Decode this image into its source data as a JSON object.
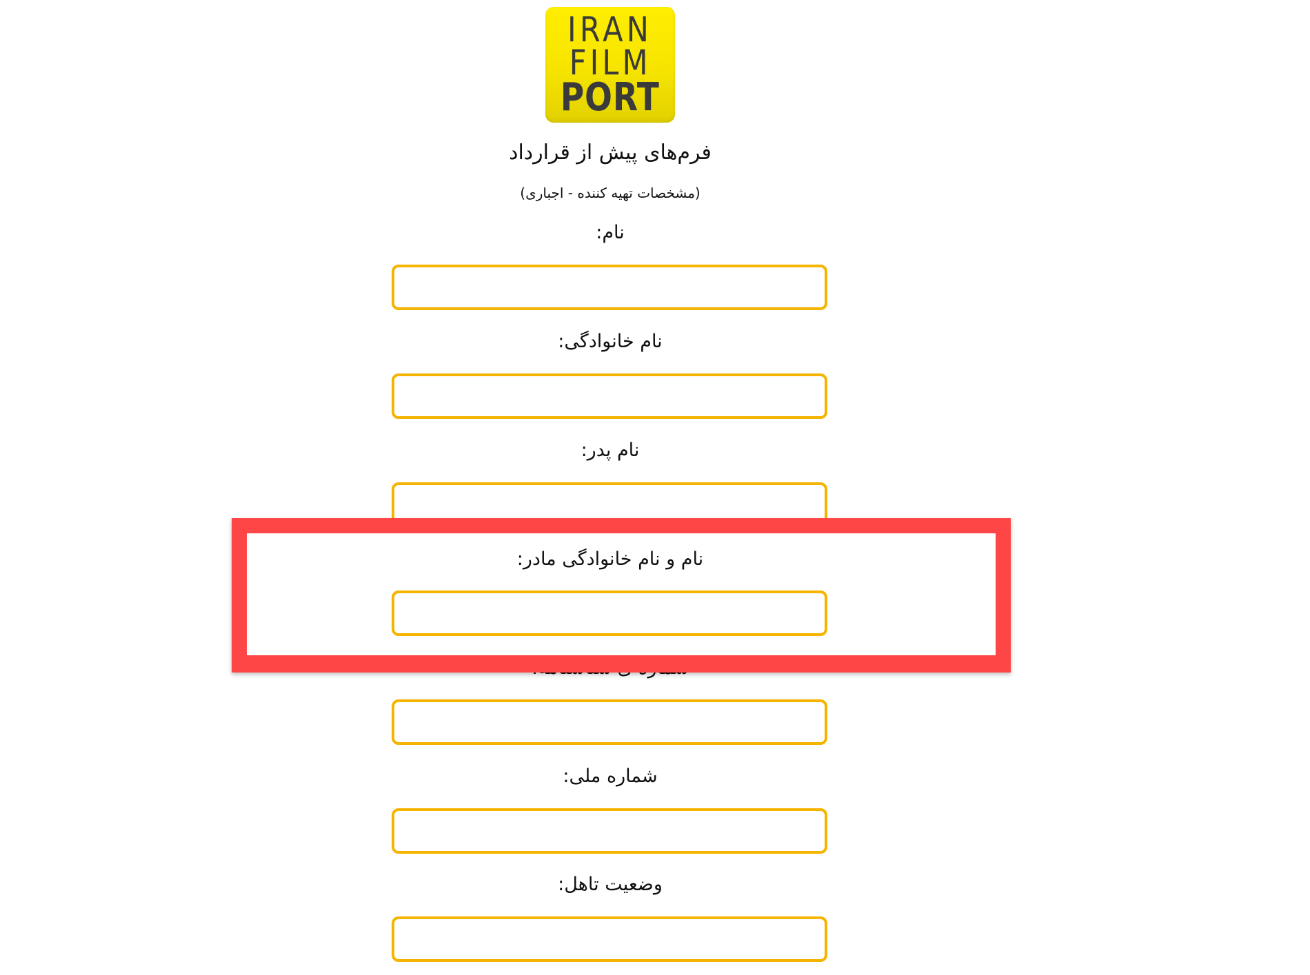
{
  "logo": {
    "line1": "IRAN",
    "line2": "FILM",
    "line3": "PORT",
    "background_color": "#f6e400"
  },
  "header": {
    "title": "فرم‌های پیش از قرارداد",
    "subtitle": "(مشخصات تهیه کننده - اجباری)"
  },
  "form": {
    "fields": [
      {
        "label": "نام:",
        "value": ""
      },
      {
        "label": "نام خانوادگی:",
        "value": ""
      },
      {
        "label": "نام پدر:",
        "value": ""
      },
      {
        "label": "نام و نام خانوادگی مادر:",
        "value": ""
      },
      {
        "label": "شماره ی شناسنامه:",
        "value": ""
      },
      {
        "label": "شماره ملی:",
        "value": ""
      },
      {
        "label": "وضعیت تاهل:",
        "value": ""
      }
    ],
    "input_border_color": "#f5b400"
  },
  "highlight": {
    "color": "#ff4646"
  }
}
